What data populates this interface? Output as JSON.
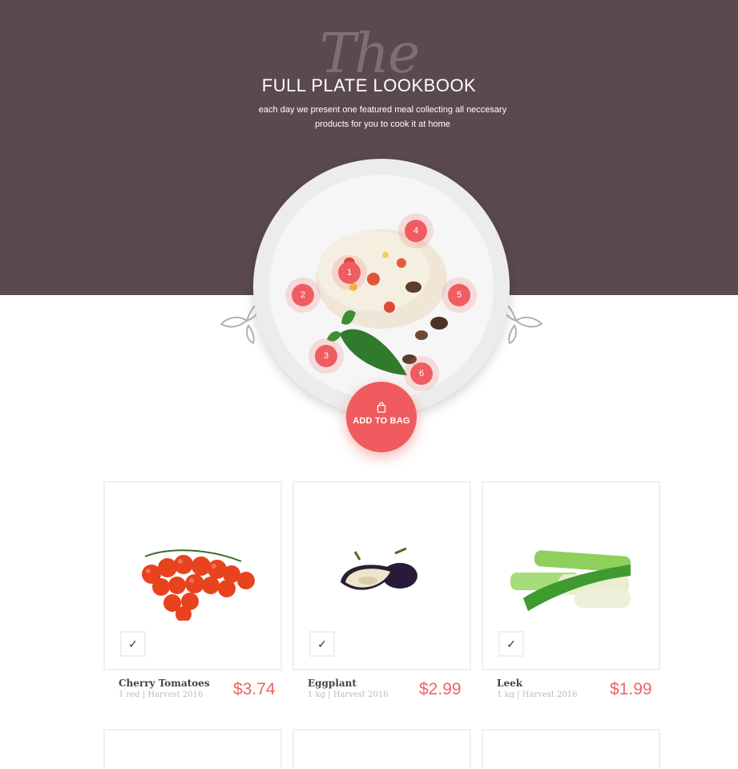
{
  "hero": {
    "script_word": "The",
    "title": "FULL PLATE LOOKBOOK",
    "subtitle": "each day we present one featured meal collecting all neccesary products for you to cook it at home"
  },
  "pins": [
    "1",
    "2",
    "3",
    "4",
    "5",
    "6"
  ],
  "bag": {
    "label": "ADD TO BAG"
  },
  "products": [
    {
      "name": "Cherry Tomatoes",
      "meta": "1 red  |  Harvest 2016",
      "price": "$3.74",
      "check": "✓"
    },
    {
      "name": "Eggplant",
      "meta": "1 kg  |  Harvest 2016",
      "price": "$2.99",
      "check": "✓"
    },
    {
      "name": "Leek",
      "meta": "1 kg  |  Harvest 2016",
      "price": "$1.99",
      "check": "✓"
    }
  ],
  "colors": {
    "hero_bg": "#5a4a4f",
    "accent": "#ef5b5e"
  }
}
